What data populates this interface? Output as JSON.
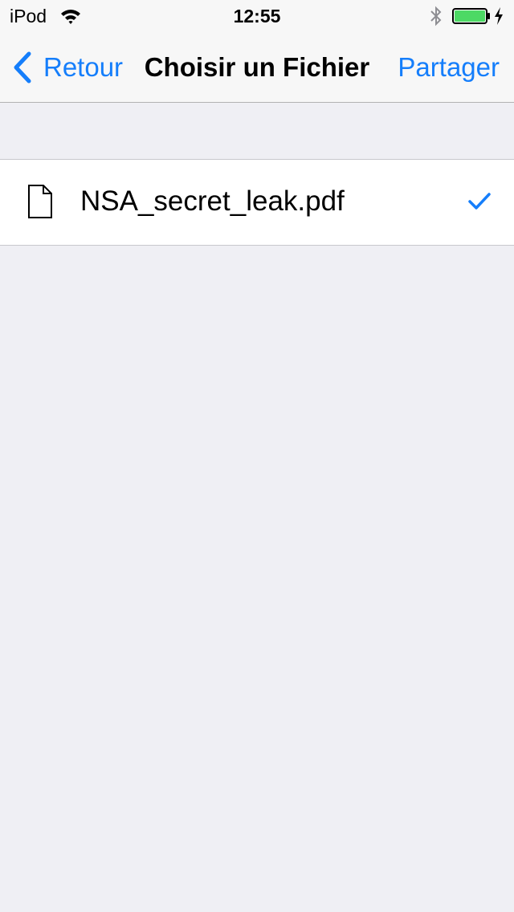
{
  "status_bar": {
    "carrier": "iPod",
    "time": "12:55",
    "icons": [
      "wifi-icon",
      "bluetooth-icon",
      "battery-icon",
      "charging-icon"
    ],
    "battery_level": 1.0,
    "battery_color": "#4cd964"
  },
  "nav": {
    "back_label": "Retour",
    "title": "Choisir un Fichier",
    "share_label": "Partager",
    "tint_color": "#157efb"
  },
  "files": [
    {
      "name": "NSA_secret_leak.pdf",
      "icon": "document-icon",
      "selected": true
    }
  ]
}
